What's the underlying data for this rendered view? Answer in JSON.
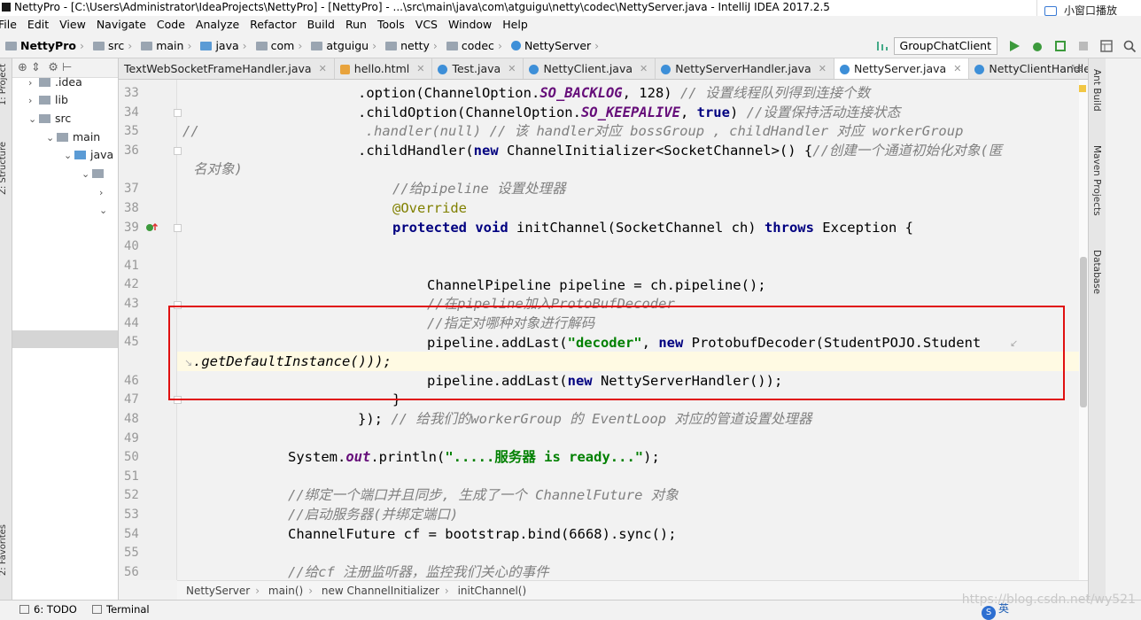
{
  "window": {
    "title": "NettyPro - [C:\\Users\\Administrator\\IdeaProjects\\NettyPro] - [NettyPro] - ...\\src\\main\\java\\com\\atguigu\\netty\\codec\\NettyServer.java - IntelliJ IDEA 2017.2.5",
    "float_button": "小窗口播放"
  },
  "menu": [
    "File",
    "Edit",
    "View",
    "Navigate",
    "Code",
    "Analyze",
    "Refactor",
    "Build",
    "Run",
    "Tools",
    "VCS",
    "Window",
    "Help"
  ],
  "breadcrumb": [
    "NettyPro",
    "src",
    "main",
    "java",
    "com",
    "atguigu",
    "netty",
    "codec",
    "NettyServer"
  ],
  "run_config": "GroupChatClient",
  "left_panels": {
    "project": "1: Project",
    "structure": "Z: Structure",
    "favorites": "2: Favorites"
  },
  "right_panels": {
    "ant": "Ant Build",
    "maven": "Maven Projects",
    "database": "Database"
  },
  "tree": [
    {
      "label": ".idea",
      "indent": 1
    },
    {
      "label": "lib",
      "indent": 1
    },
    {
      "label": "src",
      "indent": 1
    },
    {
      "label": "main",
      "indent": 2
    },
    {
      "label": "java",
      "indent": 3
    }
  ],
  "tabs": [
    {
      "label": "TextWebSocketFrameHandler.java",
      "active": false
    },
    {
      "label": "hello.html",
      "active": false
    },
    {
      "label": "Test.java",
      "active": false
    },
    {
      "label": "NettyClient.java",
      "active": false
    },
    {
      "label": "NettyServerHandler.java",
      "active": false
    },
    {
      "label": "NettyServer.java",
      "active": true
    },
    {
      "label": "NettyClientHandler.java",
      "active": false
    }
  ],
  "lines": [
    {
      "n": "33"
    },
    {
      "n": "34"
    },
    {
      "n": "35"
    },
    {
      "n": "36"
    },
    {
      "n": ""
    },
    {
      "n": "37"
    },
    {
      "n": "38"
    },
    {
      "n": "39"
    },
    {
      "n": "40"
    },
    {
      "n": "41"
    },
    {
      "n": "42"
    },
    {
      "n": "43"
    },
    {
      "n": "44"
    },
    {
      "n": "45"
    },
    {
      "n": ""
    },
    {
      "n": "46"
    },
    {
      "n": "47"
    },
    {
      "n": "48"
    },
    {
      "n": "49"
    },
    {
      "n": "50"
    },
    {
      "n": "51"
    },
    {
      "n": "52"
    },
    {
      "n": "53"
    },
    {
      "n": "54"
    },
    {
      "n": "55"
    },
    {
      "n": "56"
    }
  ],
  "code": {
    "l33a": ".option(ChannelOption.",
    "l33b": "SO_BACKLOG",
    "l33c": ", 128) ",
    "l33d": "// 设置线程队列得到连接个数",
    "l34a": ".childOption(ChannelOption.",
    "l34b": "SO_KEEPALIVE",
    "l34c": ", ",
    "l34d": "true",
    ") ": "",
    "l34e": ") ",
    "l34f": "//设置保持活动连接状态",
    "l35a": "//",
    "l35b": ".handler(null) // 该 handler对应 bossGroup , childHandler 对应 workerGroup",
    "l36a": ".childHandler(",
    "l36b": "new",
    " l36c": "",
    "l36c": " ChannelInitializer<SocketChannel>() {",
    "l36d": "//创建一个通道初始化对象(匿",
    "l36e": "名对象)",
    "l37": "//给pipeline 设置处理器",
    "l38": "@Override",
    "l39a": "protected void",
    " l39b": "",
    "l39b": " initChannel(SocketChannel ch) ",
    "l39c": "throws",
    " l39d": "",
    "l39d": " Exception {",
    "l42": "ChannelPipeline pipeline = ch.pipeline();",
    "l43": "//在pipeline加入ProtoBufDecoder",
    "l44": "//指定对哪种对象进行解码",
    "l45a": "pipeline.addLast(",
    "l45b": "\"decoder\"",
    "l45c": ", ",
    "l45d": "new",
    "l45e": " ProtobufDecoder(StudentPOJO.Student",
    "l45f": ".getDefaultInstance()));",
    "l46a": "pipeline.addLast(",
    "l46b": "new",
    "l46c": " NettyServerHandler());",
    "l47": "}",
    "l48a": "}); ",
    "l48b": "// 给我们的workerGroup 的 EventLoop 对应的管道设置处理器",
    "l50a": "System.",
    "l50b": "out",
    "l50c": ".println(",
    "l50d": "\".....服务器 is ready...\"",
    "l50e": ");",
    "l52": "//绑定一个端口并且同步, 生成了一个 ChannelFuture 对象",
    "l53": "//启动服务器(并绑定端口)",
    "l54": "ChannelFuture cf = bootstrap.bind(6668).sync();",
    "l56": "//给cf 注册监听器，监控我们关心的事件"
  },
  "editor_breadcrumbs": [
    "NettyServer",
    "main()",
    "new ChannelInitializer",
    "initChannel()"
  ],
  "status": {
    "todo": "6: TODO",
    "terminal": "Terminal"
  },
  "watermark": "https://blog.csdn.net/wy521",
  "ime": "英"
}
